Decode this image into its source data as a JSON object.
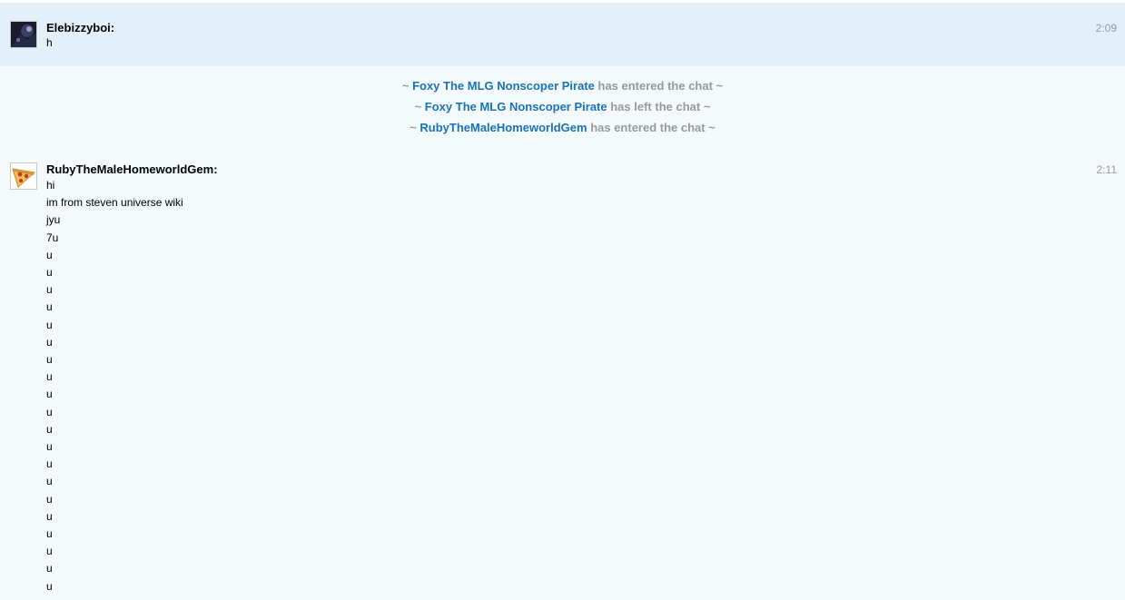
{
  "messages": [
    {
      "username": "Elebizzyboi:",
      "time": "2:09",
      "lines": [
        "h"
      ],
      "avatar_icon": "dark-avatar-icon"
    },
    {
      "username": "RubyTheMaleHomeworldGem:",
      "time": "2:11",
      "lines": [
        "hi",
        "im from steven universe wiki",
        "jyu",
        "7u",
        "u",
        "u",
        "u",
        "u",
        "u",
        "u",
        "u",
        "u",
        "u",
        "u",
        "u",
        "u",
        "u",
        "u",
        "u",
        "u",
        "u",
        "u",
        "u",
        "u"
      ],
      "avatar_icon": "pizza-avatar-icon"
    }
  ],
  "alerts": [
    {
      "prefix": "~ ",
      "user": "Foxy The MLG Nonscoper Pirate",
      "action": " has entered the chat ~"
    },
    {
      "prefix": "~ ",
      "user": "Foxy The MLG Nonscoper Pirate",
      "action": " has left the chat ~"
    },
    {
      "prefix": "~ ",
      "user": "RubyTheMaleHomeworldGem",
      "action": " has entered the chat ~"
    }
  ],
  "colors": {
    "highlight_bg": "#e3f0fa",
    "page_bg": "#f4f9fc",
    "alert_user": "#1a73b6",
    "alert_text": "#999999"
  }
}
